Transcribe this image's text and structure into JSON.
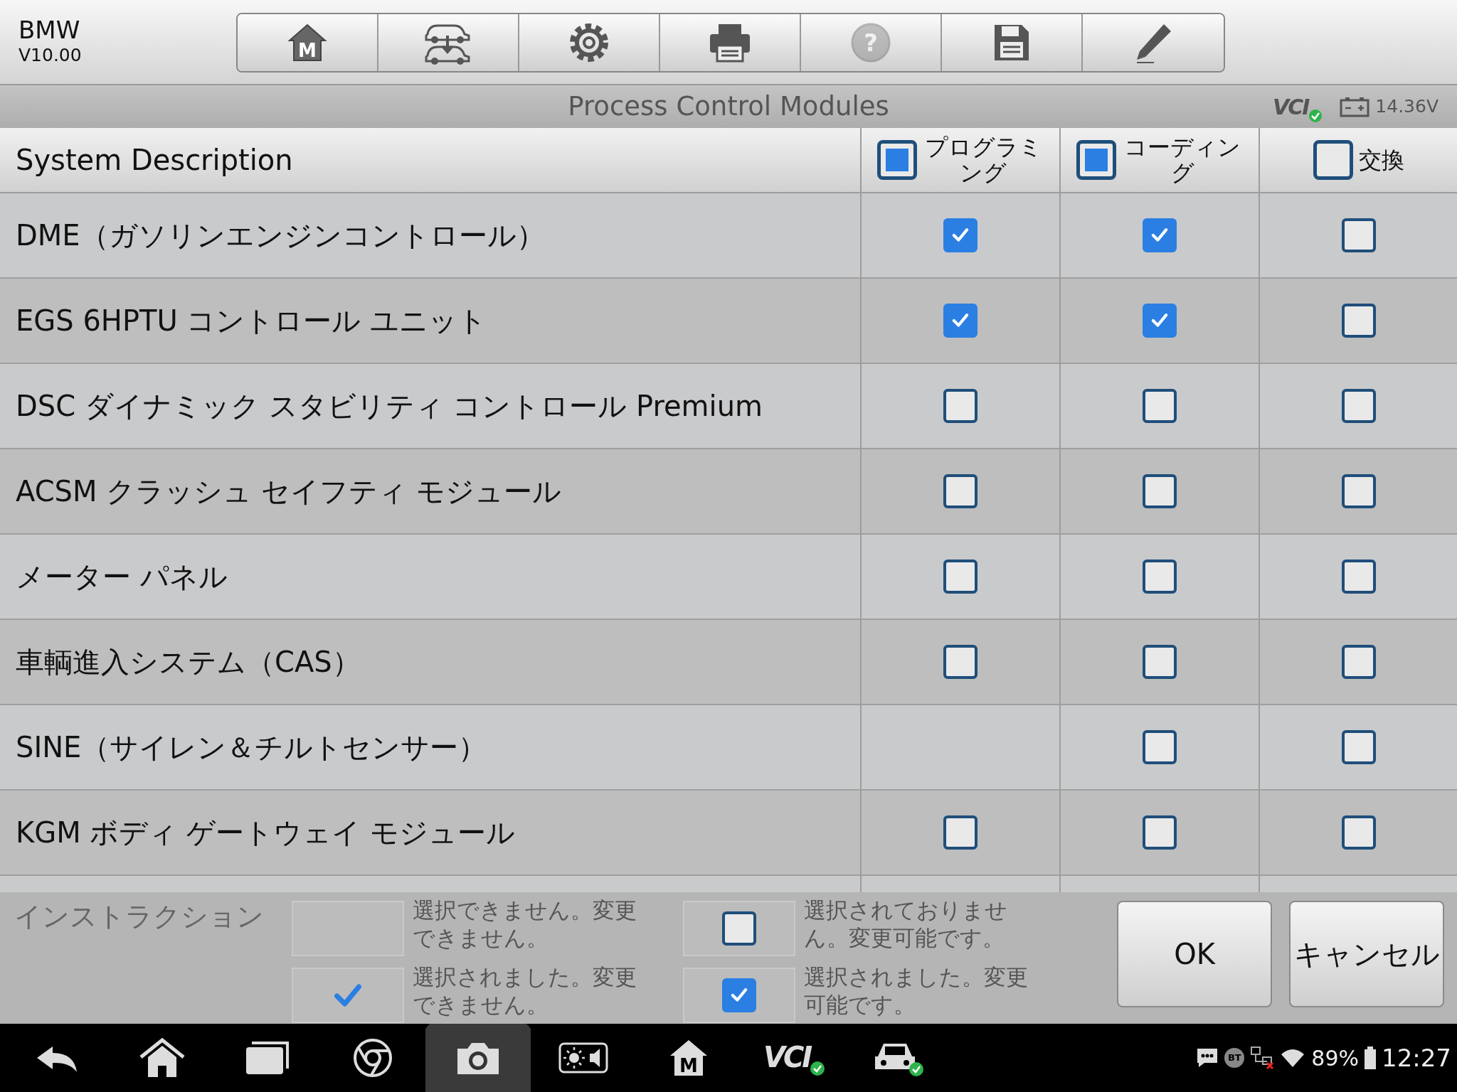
{
  "app": {
    "brand": "BMW",
    "version": "V10.00"
  },
  "toolbar": [
    {
      "kind": "home",
      "glyph": "M",
      "disabled": false
    },
    {
      "kind": "vehicle-swap",
      "disabled": false
    },
    {
      "kind": "settings",
      "disabled": false
    },
    {
      "kind": "print",
      "disabled": false
    },
    {
      "kind": "help",
      "glyph": "?",
      "disabled": true
    },
    {
      "kind": "save",
      "disabled": false
    },
    {
      "kind": "edit",
      "disabled": false
    }
  ],
  "title_bar": {
    "title": "Process Control Modules",
    "vci_label": "VCI",
    "vci_connected": true,
    "voltage": "14.36V"
  },
  "table": {
    "description_header": "System Description",
    "columns": [
      {
        "label": "プログラミング",
        "indeterminate": true
      },
      {
        "label": "コーディング",
        "indeterminate": true
      },
      {
        "label": "交換",
        "indeterminate": false
      }
    ],
    "rows": [
      {
        "description": "DME（ガソリンエンジンコントロール）",
        "cells": [
          {
            "enabled": true,
            "checked": true
          },
          {
            "enabled": true,
            "checked": true
          },
          {
            "enabled": true,
            "checked": false
          }
        ]
      },
      {
        "description": "EGS 6HPTU コントロール ユニット",
        "cells": [
          {
            "enabled": true,
            "checked": true
          },
          {
            "enabled": true,
            "checked": true
          },
          {
            "enabled": true,
            "checked": false
          }
        ]
      },
      {
        "description": "DSC ダイナミック スタビリティ コントロール Premium",
        "cells": [
          {
            "enabled": true,
            "checked": false
          },
          {
            "enabled": true,
            "checked": false
          },
          {
            "enabled": true,
            "checked": false
          }
        ]
      },
      {
        "description": "ACSM クラッシュ セイフティ モジュール",
        "cells": [
          {
            "enabled": true,
            "checked": false
          },
          {
            "enabled": true,
            "checked": false
          },
          {
            "enabled": true,
            "checked": false
          }
        ]
      },
      {
        "description": "メーター パネル",
        "cells": [
          {
            "enabled": true,
            "checked": false
          },
          {
            "enabled": true,
            "checked": false
          },
          {
            "enabled": true,
            "checked": false
          }
        ]
      },
      {
        "description": "車輌進入システム（CAS）",
        "cells": [
          {
            "enabled": true,
            "checked": false
          },
          {
            "enabled": true,
            "checked": false
          },
          {
            "enabled": true,
            "checked": false
          }
        ]
      },
      {
        "description": "SINE（サイレン＆チルトセンサー）",
        "cells": [
          {
            "enabled": false,
            "checked": false
          },
          {
            "enabled": true,
            "checked": false
          },
          {
            "enabled": true,
            "checked": false
          }
        ]
      },
      {
        "description": "KGM ボディ ゲートウェイ モジュール",
        "cells": [
          {
            "enabled": true,
            "checked": false
          },
          {
            "enabled": true,
            "checked": false
          },
          {
            "enabled": true,
            "checked": false
          }
        ]
      }
    ]
  },
  "instructions": {
    "title": "インストラクション",
    "items": [
      {
        "enabled": false,
        "checked": false,
        "text": "選択できません。変更できません。"
      },
      {
        "enabled": true,
        "checked": false,
        "text": "選択されておりません。変更可能です。"
      },
      {
        "enabled": false,
        "checked": true,
        "text": "選択されました。変更できません。"
      },
      {
        "enabled": true,
        "checked": true,
        "text": "選択されました。変更可能です。"
      }
    ]
  },
  "buttons": [
    {
      "label": "OK"
    },
    {
      "label": "キャンセル"
    }
  ],
  "nav_bar": {
    "items": [
      {
        "kind": "back",
        "selected": false
      },
      {
        "kind": "home",
        "selected": false
      },
      {
        "kind": "recents",
        "selected": false
      },
      {
        "kind": "browser",
        "selected": false
      },
      {
        "kind": "camera",
        "selected": true
      },
      {
        "kind": "brightness-volume",
        "selected": false
      },
      {
        "kind": "m-home",
        "glyph": "M",
        "selected": false
      },
      {
        "kind": "vci",
        "glyph": "VCI",
        "selected": false
      },
      {
        "kind": "car",
        "selected": false
      }
    ],
    "status": {
      "bt_label": "BT",
      "battery": "89%",
      "time": "12:27"
    }
  }
}
